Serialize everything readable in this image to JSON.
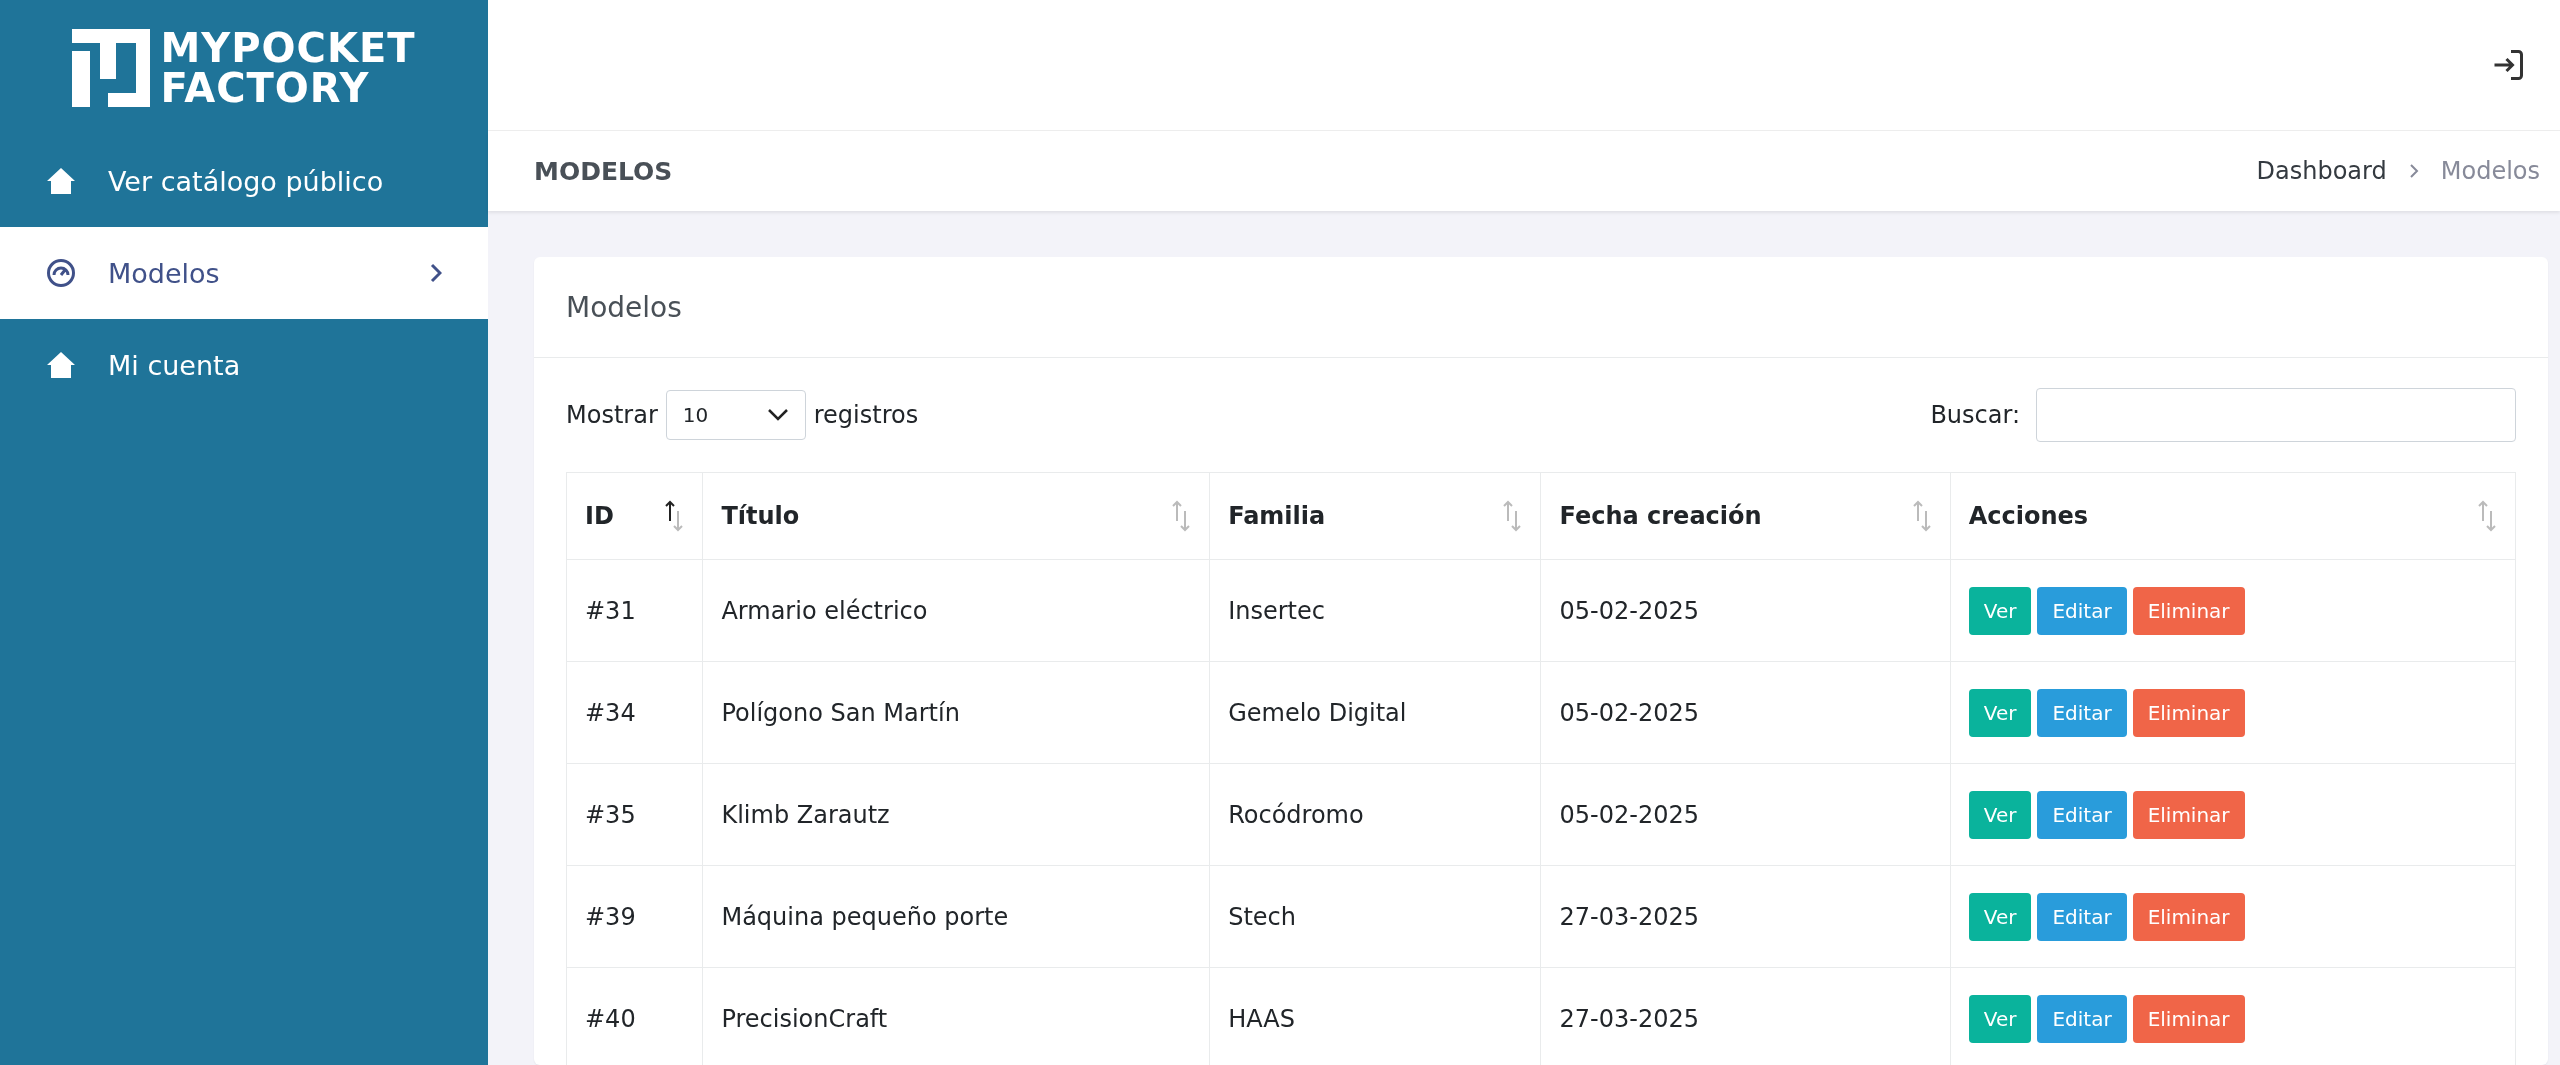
{
  "logo": {
    "line_1": "MYPOCKET",
    "line_2": "FACTORY"
  },
  "sidebar": {
    "items": [
      {
        "label": "Ver catálogo público",
        "selected": false,
        "has_arrow": false
      },
      {
        "label": "Modelos",
        "selected": true,
        "has_arrow": true
      },
      {
        "label": "Mi cuenta",
        "selected": false,
        "has_arrow": false
      }
    ]
  },
  "page_title": "MODELOS",
  "breadcrumb": [
    {
      "label": "Dashboard",
      "current": false
    },
    {
      "label": "Modelos",
      "current": true
    }
  ],
  "card": {
    "title": "Modelos",
    "length": {
      "before": "Mostrar",
      "value": "10",
      "after": "registros"
    },
    "search": {
      "label": "Buscar:"
    },
    "table": {
      "columns": [
        {
          "label": "ID",
          "sorted": true
        },
        {
          "label": "Título",
          "sorted": false
        },
        {
          "label": "Familia",
          "sorted": false
        },
        {
          "label": "Fecha creación",
          "sorted": false
        },
        {
          "label": "Acciones",
          "sorted": false
        }
      ],
      "rows": [
        {
          "cells": [
            "#31",
            "Armario eléctrico",
            "Insertec",
            "05-02-2025"
          ],
          "actions": [
            {
              "label": "Ver",
              "kind": "view"
            },
            {
              "label": "Editar",
              "kind": "edit"
            },
            {
              "label": "Eliminar",
              "kind": "delete"
            }
          ]
        },
        {
          "cells": [
            "#34",
            "Polígono San Martín",
            "Gemelo Digital",
            "05-02-2025"
          ],
          "actions": [
            {
              "label": "Ver",
              "kind": "view"
            },
            {
              "label": "Editar",
              "kind": "edit"
            },
            {
              "label": "Eliminar",
              "kind": "delete"
            }
          ]
        },
        {
          "cells": [
            "#35",
            "Klimb Zarautz",
            "Rocódromo",
            "05-02-2025"
          ],
          "actions": [
            {
              "label": "Ver",
              "kind": "view"
            },
            {
              "label": "Editar",
              "kind": "edit"
            },
            {
              "label": "Eliminar",
              "kind": "delete"
            }
          ]
        },
        {
          "cells": [
            "#39",
            "Máquina pequeño porte",
            "Stech",
            "27-03-2025"
          ],
          "actions": [
            {
              "label": "Ver",
              "kind": "view"
            },
            {
              "label": "Editar",
              "kind": "edit"
            },
            {
              "label": "Eliminar",
              "kind": "delete"
            }
          ]
        },
        {
          "cells": [
            "#40",
            "PrecisionCraft",
            "HAAS",
            "27-03-2025"
          ],
          "actions": [
            {
              "label": "Ver",
              "kind": "view"
            },
            {
              "label": "Editar",
              "kind": "edit"
            },
            {
              "label": "Eliminar",
              "kind": "delete"
            }
          ]
        }
      ]
    }
  }
}
